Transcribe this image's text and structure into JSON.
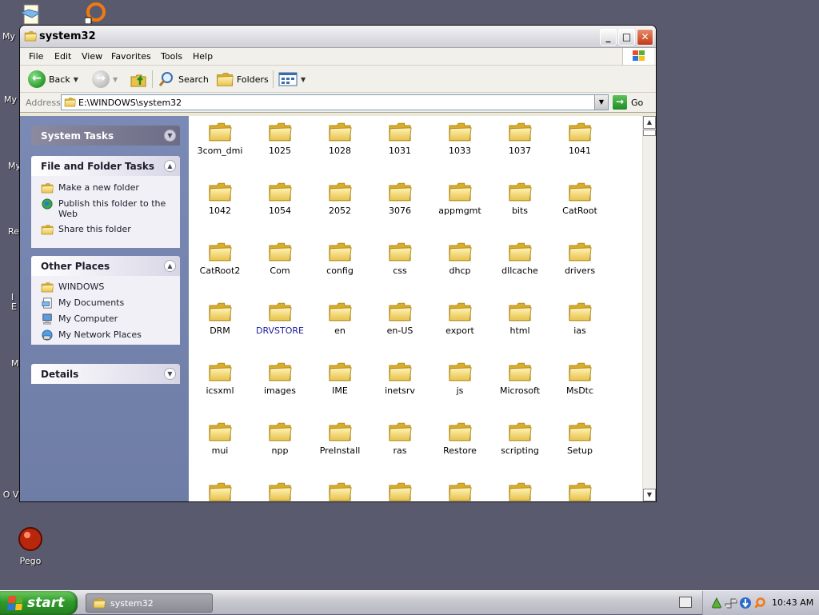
{
  "desktop": {
    "icons": [
      {
        "label": "My",
        "icon": "my-documents-icon"
      },
      {
        "label": "My",
        "icon": "my-computer-icon"
      },
      {
        "label": "My",
        "icon": "my-network-icon"
      },
      {
        "label": "Re",
        "icon": "recycle-bin-icon"
      },
      {
        "label": "I E",
        "icon": "internet-explorer-icon"
      },
      {
        "label": "M",
        "icon": "media-icon"
      },
      {
        "label": "O VirtualBox",
        "icon": "virtualbox-icon"
      },
      {
        "label": "Pego",
        "icon": "pego-icon"
      }
    ]
  },
  "window": {
    "title": "system32",
    "controls": {
      "minimize": "_",
      "maximize": "□",
      "close": "✕"
    }
  },
  "menu": [
    "File",
    "Edit",
    "View",
    "Favorites",
    "Tools",
    "Help"
  ],
  "toolbar": {
    "back": "Back",
    "search": "Search",
    "folders": "Folders"
  },
  "address": {
    "label": "Address",
    "value": "E:\\WINDOWS\\system32",
    "go": "Go"
  },
  "taskpane": {
    "system_tasks": "System Tasks",
    "file_folder_tasks": {
      "title": "File and Folder Tasks",
      "items": [
        "Make a new folder",
        "Publish this folder to the Web",
        "Share this folder"
      ]
    },
    "other_places": {
      "title": "Other Places",
      "items": [
        "WINDOWS",
        "My Documents",
        "My Computer",
        "My Network Places"
      ]
    },
    "details": "Details"
  },
  "folders": [
    "3com_dmi",
    "1025",
    "1028",
    "1031",
    "1033",
    "1037",
    "1041",
    "1042",
    "1054",
    "2052",
    "3076",
    "appmgmt",
    "bits",
    "CatRoot",
    "CatRoot2",
    "Com",
    "config",
    "css",
    "dhcp",
    "dllcache",
    "drivers",
    "DRM",
    "DRVSTORE",
    "en",
    "en-US",
    "export",
    "html",
    "ias",
    "icsxml",
    "images",
    "IME",
    "inetsrv",
    "js",
    "Microsoft",
    "MsDtc",
    "mui",
    "npp",
    "PreInstall",
    "ras",
    "Restore",
    "scripting",
    "Setup",
    "",
    "",
    "",
    "",
    "",
    "",
    ""
  ],
  "taskbar": {
    "start": "start",
    "task": "system32",
    "clock": "10:43 AM"
  },
  "colors": {
    "desktop": "#5a5a6e",
    "start_green": "#2e9a2a",
    "folder_yellow": "#f2d56b"
  }
}
